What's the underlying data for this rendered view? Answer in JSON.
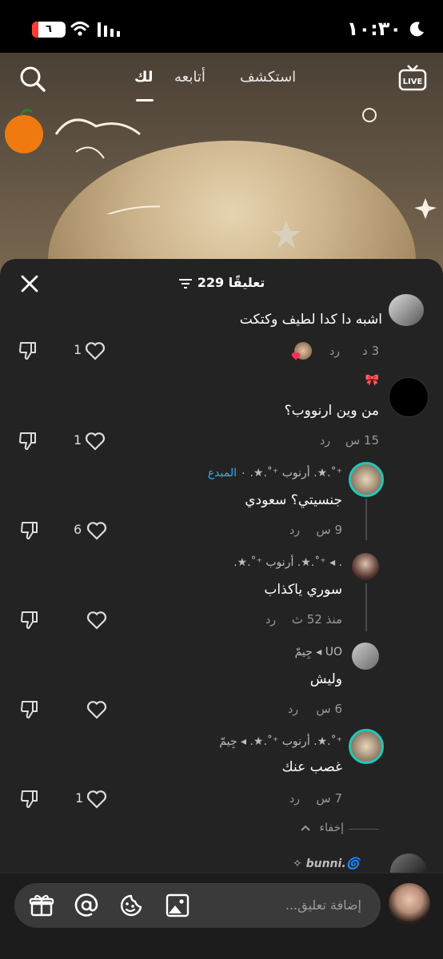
{
  "status_bar": {
    "time": "١٠:٣٠",
    "battery": "٦"
  },
  "top_nav": {
    "tabs": [
      {
        "label": "لك",
        "active": true
      },
      {
        "label": "أتابعه",
        "active": false
      },
      {
        "label": "استكشف",
        "active": false
      }
    ],
    "live_label": "LIVE"
  },
  "sheet": {
    "count_label": "229 تعليقًا"
  },
  "comments": [
    {
      "text": "اشبه دا كدا لطيف وكتكت",
      "time": "3 د",
      "reply": "رد",
      "likes": "1"
    },
    {
      "username": "🎀",
      "text": "من وين ارنووب؟",
      "time": "15 س",
      "reply": "رد",
      "likes": "1"
    },
    {
      "username": "⁺˚.★. أرنوب ⁺˚.★. ٠ المبدع",
      "username_highlight": "المبدع",
      "text": "جنسيتي؟ سعودي",
      "time": "9 س",
      "reply": "رد",
      "likes": "6"
    },
    {
      "username": ". ◂ ⁺˚.★. أرنوب ⁺˚.★.",
      "text": "سوري ياكذاب",
      "time": "منذ 52 ث",
      "reply": "رد",
      "likes": ""
    },
    {
      "username": "UO ◂ جِيمّ",
      "text": "وليش",
      "time": "6 س",
      "reply": "رد",
      "likes": ""
    },
    {
      "username": "⁺˚.★. أرنوب ⁺˚.★. ◂ جِيمّ",
      "text": "غصب عنك",
      "time": "7 س",
      "reply": "رد",
      "likes": "1"
    }
  ],
  "hide_label": "إخفاء",
  "next_username": "✧ bunni.🌀",
  "input": {
    "placeholder": "إضافة تعليق..."
  },
  "colors": {
    "sheet_bg": "#232323",
    "accent_like": "#fe2c55",
    "highlight_name": "#29b6f6"
  }
}
